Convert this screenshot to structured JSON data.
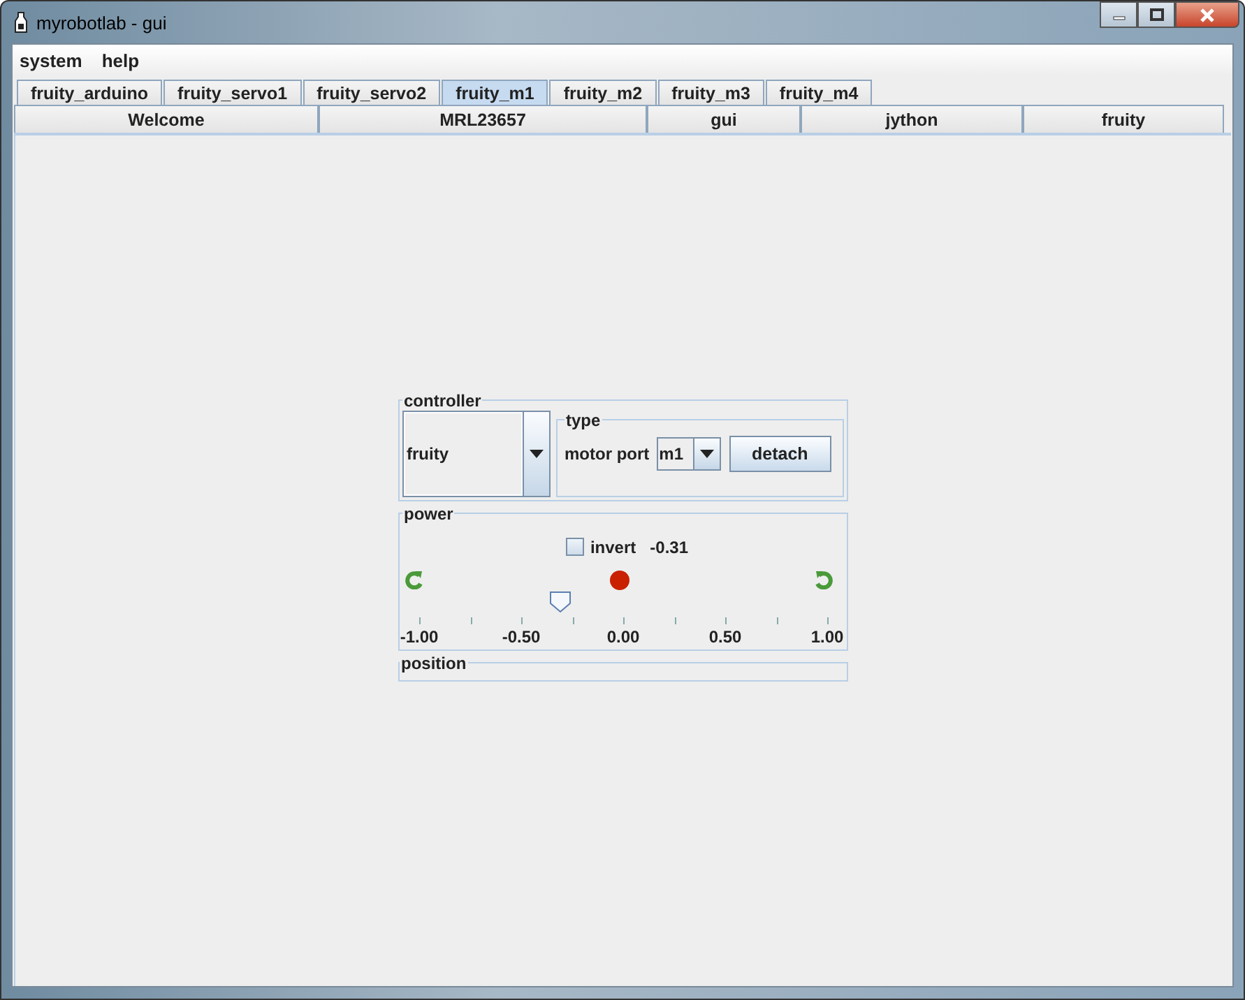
{
  "window": {
    "title": "myrobotlab - gui"
  },
  "menu": [
    "system",
    "help"
  ],
  "tabs_top": [
    {
      "label": "fruity_arduino",
      "selected": false
    },
    {
      "label": "fruity_servo1",
      "selected": false
    },
    {
      "label": "fruity_servo2",
      "selected": false
    },
    {
      "label": "fruity_m1",
      "selected": true
    },
    {
      "label": "fruity_m2",
      "selected": false
    },
    {
      "label": "fruity_m3",
      "selected": false
    },
    {
      "label": "fruity_m4",
      "selected": false
    }
  ],
  "tabs_bottom": [
    {
      "label": "Welcome",
      "selected": false
    },
    {
      "label": "MRL23657",
      "selected": false
    },
    {
      "label": "gui",
      "selected": false
    },
    {
      "label": "jython",
      "selected": false
    },
    {
      "label": "fruity",
      "selected": false
    }
  ],
  "controller": {
    "title": "controller",
    "value": "fruity",
    "type": {
      "title": "type",
      "label": "motor port",
      "port": "m1",
      "button": "detach"
    }
  },
  "power": {
    "title": "power",
    "invert": {
      "label": "invert",
      "checked": false
    },
    "reading": "-0.31",
    "slider": {
      "level": 0.345,
      "labels": [
        "-1.00",
        "-0.50",
        "0.00",
        "0.50",
        "1.00"
      ]
    }
  },
  "position": {
    "title": "position"
  }
}
